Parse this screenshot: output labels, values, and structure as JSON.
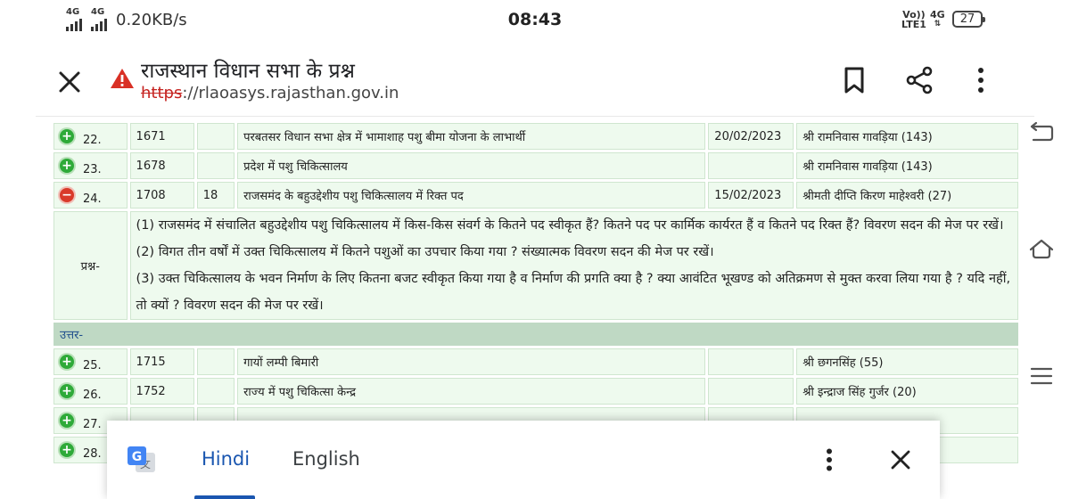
{
  "status_bar": {
    "signal1": "4G",
    "signal2": "4G",
    "speed": "0.20KB/s",
    "time": "08:43",
    "volte_top": "Vo))",
    "volte_bottom": "LTE1",
    "net_type": "4G",
    "battery": "27"
  },
  "toolbar": {
    "title": "राजस्थान विधान सभा के प्रश्न",
    "url_scheme": "https",
    "url_rest": "://rlaoasys.rajasthan.gov.in",
    "icons": [
      "close-icon",
      "warning-icon",
      "bookmark-icon",
      "share-icon",
      "more-vert-icon"
    ]
  },
  "table": {
    "rows": [
      {
        "sno": "22.",
        "id": "1671",
        "num": "",
        "subject": "परबतसर विधान सभा क्षेत्र में भामाशाह पशु बीमा योजना के लाभार्थी",
        "date": "20/02/2023",
        "member": "श्री रामनिवास गावड़िया (143)",
        "expanded": false
      },
      {
        "sno": "23.",
        "id": "1678",
        "num": "",
        "subject": "प्रदेश में पशु चिकित्सालय",
        "date": "",
        "member": "श्री रामनिवास गावड़िया (143)",
        "expanded": false
      },
      {
        "sno": "24.",
        "id": "1708",
        "num": "18",
        "subject": "राजसमंद के बहुउद्देशीय पशु चिकित्सालय में रिक्त पद",
        "date": "15/02/2023",
        "member": "श्रीमती दीप्ति किरण माहेश्वरी (27)",
        "expanded": true
      }
    ],
    "question_label": "प्रश्न-",
    "question_lines": [
      "(1) राजसमंद में संचालित बहुउद्देशीय पशु चिकित्सालय में किस-किस संवर्ग के कितने पद स्वीकृत हैं? कितने पद पर कार्मिक कार्यरत हैं व कितने पद रिक्त हैं? विवरण सदन की मेज पर रखें।",
      "(2) विगत तीन वर्षों में उक्त चिकित्सालय में कितने पशुओं का उपचार किया गया ? संख्यात्मक विवरण सदन की मेज पर रखें।",
      "(3) उक्त चिकित्सालय के भवन निर्माण के लिए कितना बजट स्वीकृत किया गया है व निर्माण की प्रगति क्या है ? क्या आवंटित भूखण्ड को अतिक्रमण से मुक्त करवा लिया गया है ? यदि नहीं, तो क्यों ? विवरण सदन की मेज पर रखें।"
    ],
    "answer_label": "उत्तर-",
    "rows_after": [
      {
        "sno": "25.",
        "id": "1715",
        "num": "",
        "subject": "गायों लम्पी बिमारी",
        "date": "",
        "member": "श्री छगनसिंह (55)"
      },
      {
        "sno": "26.",
        "id": "1752",
        "num": "",
        "subject": "राज्य में पशु चिकित्सा केन्द्र",
        "date": "",
        "member": "श्री इन्द्राज सिंह गुर्जर (20)"
      },
      {
        "sno": "27.",
        "id": "",
        "num": "",
        "subject": "",
        "date": "",
        "member": ""
      },
      {
        "sno": "28.",
        "id": "",
        "num": "",
        "subject": "",
        "date": "",
        "member": ""
      }
    ]
  },
  "translate_bar": {
    "tab_hindi": "Hindi",
    "tab_english": "English",
    "active_tab": "Hindi",
    "accent": "#1a56b0"
  }
}
